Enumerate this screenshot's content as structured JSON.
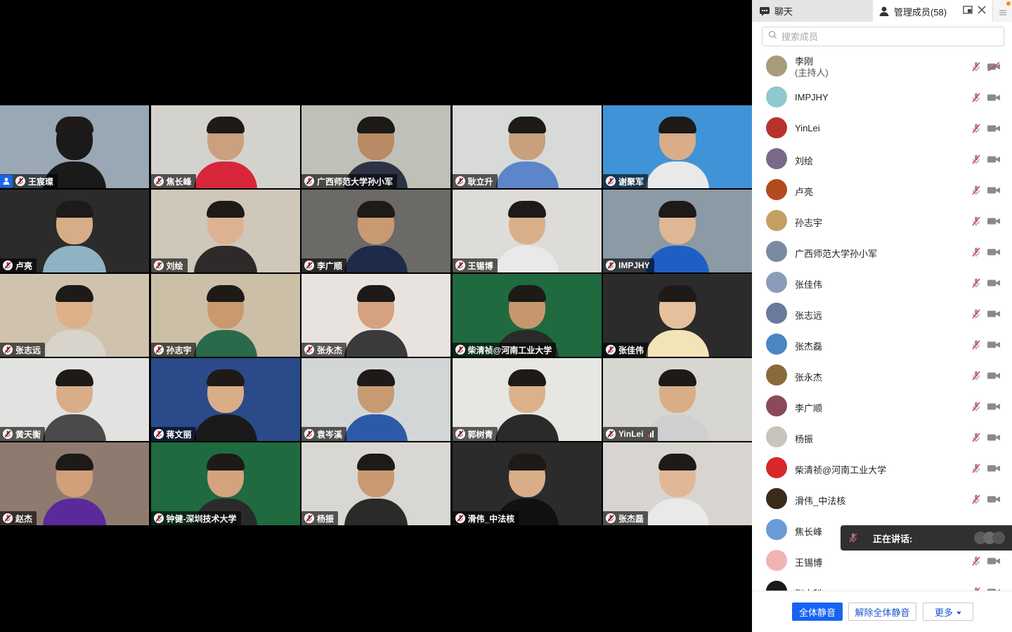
{
  "grid": {
    "tiles": [
      {
        "name": "王宸璨",
        "host": true,
        "bg": "#9aa7b4",
        "skin": "#1a1a1a",
        "shirt": "#1a1a1a"
      },
      {
        "name": "焦长峰",
        "bg": "#d4d2cc",
        "skin": "#caa07e",
        "shirt": "#d8263a"
      },
      {
        "name": "广西师范大学孙小军",
        "bg": "#bfc1b8",
        "skin": "#b98a64",
        "shirt": "#2d3245"
      },
      {
        "name": "耿立升",
        "bg": "#d7dad8",
        "skin": "#c8a07c",
        "shirt": "#5d85c9"
      },
      {
        "name": "谢聚军",
        "bg": "#3f93d6",
        "skin": "#d8ad88",
        "shirt": "#e9e9e9"
      },
      {
        "name": "卢亮",
        "bg": "#2b2b2b",
        "skin": "#d7ad87",
        "shirt": "#8fb3c3"
      },
      {
        "name": "刘绘",
        "bg": "#cfc7b8",
        "skin": "#ddb292",
        "shirt": "#2e2a2a"
      },
      {
        "name": "李广顺",
        "bg": "#6b6a66",
        "skin": "#c79a73",
        "shirt": "#1e2b48"
      },
      {
        "name": "王锡博",
        "bg": "#dedcd8",
        "skin": "#d9b08a",
        "shirt": "#e9e9e9"
      },
      {
        "name": "IMPJHY",
        "bg": "#8c9aa6",
        "skin": "#e0b795",
        "shirt": "#1f5fc4"
      },
      {
        "name": "张志远",
        "bg": "#cfc3ad",
        "skin": "#ddb08a",
        "shirt": "#d8d3cb"
      },
      {
        "name": "孙志宇",
        "bg": "#cbbfa8",
        "skin": "#c99a70",
        "shirt": "#2a6a4a"
      },
      {
        "name": "张永杰",
        "bg": "#e9e3df",
        "skin": "#d4a27e",
        "shirt": "#3a3a3a"
      },
      {
        "name": "柴清祯@河南工业大学",
        "bg": "#1f6a3f",
        "skin": "#c8966e",
        "shirt": "#2a2a2a"
      },
      {
        "name": "张佳伟",
        "bg": "#2b2b2b",
        "skin": "#e6c09d",
        "shirt": "#f3e4b8"
      },
      {
        "name": "黄天衡",
        "bg": "#e2e2e0",
        "skin": "#d8ad88",
        "shirt": "#4a4a4a"
      },
      {
        "name": "蒋文丽",
        "bg": "#2a4a8a",
        "skin": "#d8ad88",
        "shirt": "#1a1a1a"
      },
      {
        "name": "袁岑溪",
        "bg": "#d3d6d6",
        "skin": "#c89a72",
        "shirt": "#2d5aa8"
      },
      {
        "name": "郭树青",
        "bg": "#e6e6e3",
        "skin": "#dcb08a",
        "shirt": "#2a2a2a"
      },
      {
        "name": "YinLei",
        "bg": "#d8d6d0",
        "skin": "#d8ad88",
        "shirt": "#cfcfcf",
        "signal": true
      },
      {
        "name": "赵杰",
        "bg": "#8f7a70",
        "skin": "#d19f7a",
        "shirt": "#5a2a9a"
      },
      {
        "name": "钟健-深圳技术大学",
        "bg": "#1f6a3f",
        "skin": "#d3a37d",
        "shirt": "#2a2a2a"
      },
      {
        "name": "杨振",
        "bg": "#d9d7d2",
        "skin": "#c99a72",
        "shirt": "#2a2a2a"
      },
      {
        "name": "滑伟_中法核",
        "bg": "#2b2b2b",
        "skin": "#d8ad88",
        "shirt": "#111111"
      },
      {
        "name": "张杰磊",
        "bg": "#d8d4d0",
        "skin": "#e0b895",
        "shirt": "#e9e9e9"
      }
    ]
  },
  "panel": {
    "tab_chat": "聊天",
    "tab_members": "管理成员(58)",
    "search_placeholder": "搜索成员",
    "members": [
      {
        "name": "李刚",
        "sub": "(主持人)",
        "avatar": "#a89c7a",
        "cam_off": true
      },
      {
        "name": "IMPJHY",
        "avatar": "#8fc9cf"
      },
      {
        "name": "YinLei",
        "avatar": "#b8322e"
      },
      {
        "name": "刘绘",
        "avatar": "#7a6a8a"
      },
      {
        "name": "卢亮",
        "avatar": "#b34a1f"
      },
      {
        "name": "孙志宇",
        "avatar": "#c4a062"
      },
      {
        "name": "广西师范大学孙小军",
        "avatar": "#7a8aa0"
      },
      {
        "name": "张佳伟",
        "avatar": "#8a9cb8"
      },
      {
        "name": "张志远",
        "avatar": "#6a7a9a"
      },
      {
        "name": "张杰磊",
        "avatar": "#4a86c4"
      },
      {
        "name": "张永杰",
        "avatar": "#8a6a3a"
      },
      {
        "name": "李广顺",
        "avatar": "#8a4a5a"
      },
      {
        "name": "杨振",
        "avatar": "#c8c4bc"
      },
      {
        "name": "柴清祯@河南工业大学",
        "avatar": "#d8262a"
      },
      {
        "name": "滑伟_中法核",
        "avatar": "#3a2a1a"
      },
      {
        "name": "焦长峰",
        "avatar": "#6a9ad8"
      },
      {
        "name": "王锡博",
        "avatar": "#f0b4b4"
      },
      {
        "name": "张杰科",
        "avatar": "#1a1a1a"
      }
    ],
    "btn_mute_all": "全体静音",
    "btn_unmute_all": "解除全体静音",
    "btn_more": "更多"
  },
  "speaking": {
    "label": "正在讲话:"
  },
  "colors": {
    "accent": "#1664f0",
    "mic_muted": "#d9283c"
  }
}
